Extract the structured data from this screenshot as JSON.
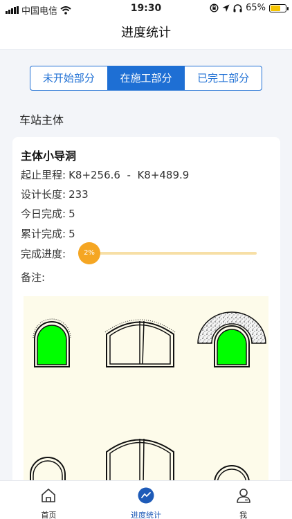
{
  "status": {
    "carrier": "中国电信",
    "time": "19:30",
    "battery": "65%"
  },
  "nav": {
    "title": "进度统计"
  },
  "tabs": [
    "未开始部分",
    "在施工部分",
    "已完工部分"
  ],
  "section": {
    "title": "车站主体"
  },
  "card": {
    "name": "主体小导洞",
    "range_label": "起止里程:",
    "range_value": "K8+256.6  -  K8+489.9",
    "length_label": "设计长度:",
    "length_value": "233",
    "today_label": "今日完成:",
    "today_value": "5",
    "total_label": "累计完成:",
    "total_value": "5",
    "progress_label": "完成进度:",
    "progress_text": "2%",
    "progress_fraction": 0.02,
    "note_label": "备注:"
  },
  "colors": {
    "primary": "#1e6fd4",
    "progress": "#f5a623",
    "done_fill": "#00ff00"
  },
  "tabbar": {
    "home": "首页",
    "stats": "进度统计",
    "me": "我"
  }
}
